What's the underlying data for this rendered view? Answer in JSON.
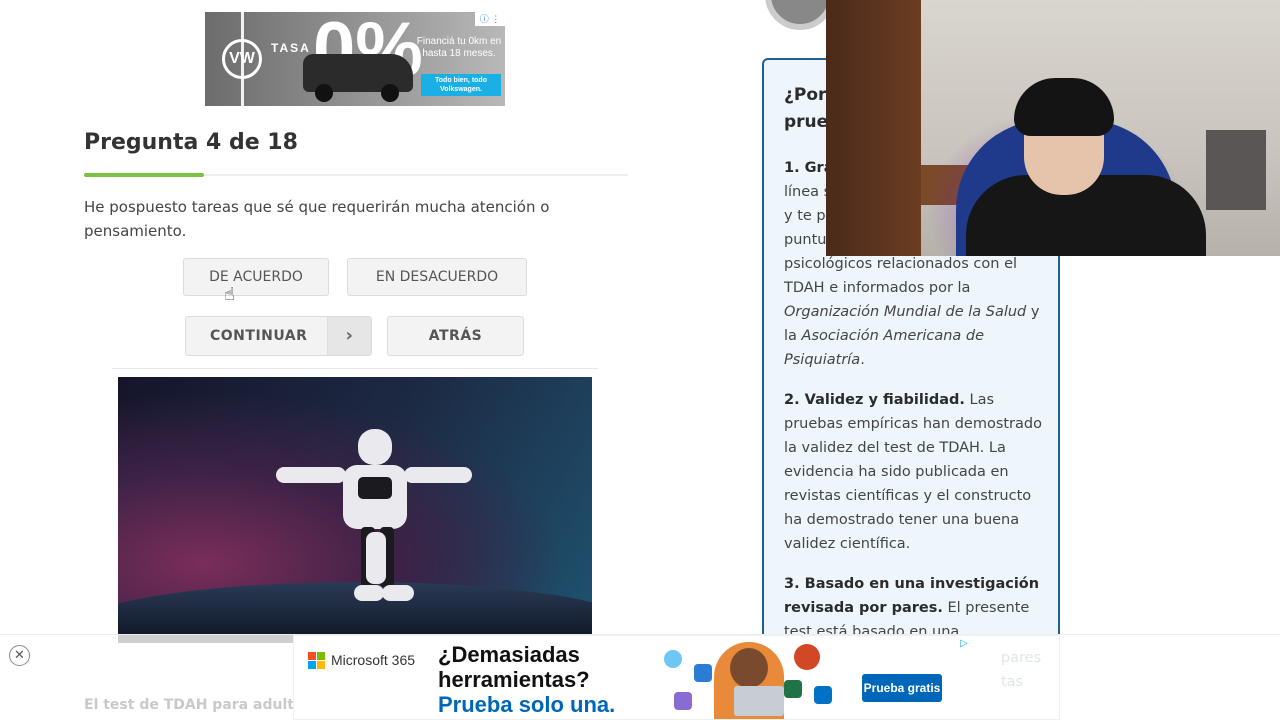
{
  "top_ad": {
    "logo": "VW",
    "tasa": "TASA",
    "rate": "0%",
    "financing": "Financiá tu 0km en hasta 18 meses.",
    "tagline": "Todo bien, todo Volkswagen.",
    "icons": "ⓘ ⋮"
  },
  "quiz": {
    "title": "Pregunta 4 de 18",
    "progress": 0.22,
    "question": "He pospuesto tareas que sé que requerirán mucha atención o pensamiento.",
    "agree_label": "DE ACUERDO",
    "disagree_label": "EN DESACUERDO",
    "continue_label": "CONTINUAR",
    "continue_arrow": "›",
    "back_label": "ATRÁS"
  },
  "sidebar": {
    "heading": "¿Por\nprue",
    "p1_bold": "1. Gra",
    "p1_lines": [
      "línea s",
      "y te p",
      "puntu"
    ],
    "p1_rest": "psicológicos relacionados con el TDAH e informados por la ",
    "p1_org1": "Organización Mundial de la Salud",
    "p1_and": " y la ",
    "p1_org2": "Asociación Americana de Psiquiatría",
    "p1_end": ".",
    "p2_bold": "2. Validez y fiabilidad.",
    "p2_text": " Las pruebas empíricas han demostrado la validez del test de TDAH. La evidencia ha sido publicada en revistas científicas y el constructo ha demostrado tener una buena validez científica.",
    "p3_bold": "3. Basado en una investigación revisada por pares.",
    "p3_text": " El presente test está basado en una",
    "faded_1": "pares",
    "faded_2": "tas"
  },
  "bottom_ad": {
    "close": "✕",
    "brand": "Microsoft 365",
    "headline_1": "¿Demasiadas",
    "headline_2": "herramientas?",
    "headline_3": "Prueba solo una.",
    "cta": "Prueba gratis",
    "adchoice": "▷"
  },
  "below_heading": "El test de TDAH para adult",
  "colors": {
    "accent_green": "#7cc242",
    "sidebar_border": "#1f5f8b",
    "ms_blue": "#0067b8"
  }
}
